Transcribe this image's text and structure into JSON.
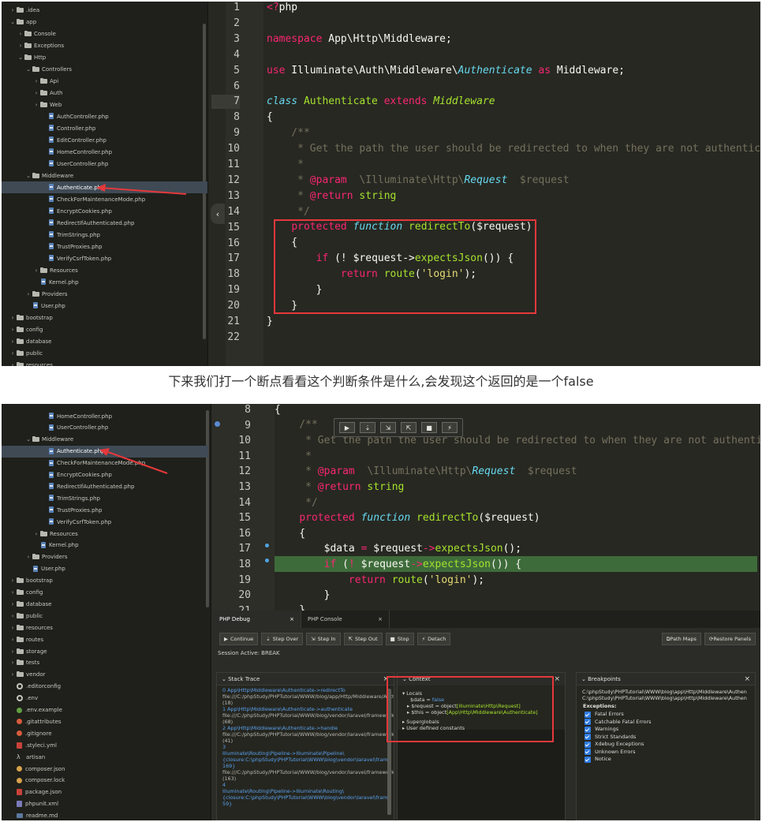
{
  "screenshot1": {
    "tree": [
      {
        "label": ".idea",
        "arrow": "›",
        "icon": "folder"
      },
      {
        "label": "app",
        "arrow": "⌄",
        "icon": "folder"
      },
      {
        "label": "Console",
        "arrow": "›",
        "icon": "folder"
      },
      {
        "label": "Exceptions",
        "arrow": "›",
        "icon": "folder"
      },
      {
        "label": "Http",
        "arrow": "⌄",
        "icon": "folder"
      },
      {
        "label": "Controllers",
        "arrow": "⌄",
        "icon": "folder"
      },
      {
        "label": "Api",
        "arrow": "›",
        "icon": "folder"
      },
      {
        "label": "Auth",
        "arrow": "›",
        "icon": "folder"
      },
      {
        "label": "Web",
        "arrow": "›",
        "icon": "folder"
      },
      {
        "label": "AuthController.php",
        "arrow": "",
        "icon": "php"
      },
      {
        "label": "Controller.php",
        "arrow": "",
        "icon": "php"
      },
      {
        "label": "EditController.php",
        "arrow": "",
        "icon": "php"
      },
      {
        "label": "HomeController.php",
        "arrow": "",
        "icon": "php"
      },
      {
        "label": "UserController.php",
        "arrow": "",
        "icon": "php"
      },
      {
        "label": "Middleware",
        "arrow": "⌄",
        "icon": "folder"
      },
      {
        "label": "Authenticate.php",
        "arrow": "",
        "icon": "php",
        "selected": true
      },
      {
        "label": "CheckForMaintenanceMode.php",
        "arrow": "",
        "icon": "php"
      },
      {
        "label": "EncryptCookies.php",
        "arrow": "",
        "icon": "php"
      },
      {
        "label": "RedirectIfAuthenticated.php",
        "arrow": "",
        "icon": "php"
      },
      {
        "label": "TrimStrings.php",
        "arrow": "",
        "icon": "php"
      },
      {
        "label": "TrustProxies.php",
        "arrow": "",
        "icon": "php"
      },
      {
        "label": "VerifyCsrfToken.php",
        "arrow": "",
        "icon": "php"
      },
      {
        "label": "Resources",
        "arrow": "›",
        "icon": "folder"
      },
      {
        "label": "Kernel.php",
        "arrow": "",
        "icon": "php"
      },
      {
        "label": "Providers",
        "arrow": "›",
        "icon": "folder"
      },
      {
        "label": "User.php",
        "arrow": "",
        "icon": "php"
      },
      {
        "label": "bootstrap",
        "arrow": "›",
        "icon": "folder"
      },
      {
        "label": "config",
        "arrow": "›",
        "icon": "folder"
      },
      {
        "label": "database",
        "arrow": "›",
        "icon": "folder"
      },
      {
        "label": "public",
        "arrow": "›",
        "icon": "folder"
      },
      {
        "label": "resources",
        "arrow": "›",
        "icon": "folder"
      }
    ],
    "collapse_glyph": "‹",
    "line_numbers": [
      "1",
      "2",
      "3",
      "4",
      "5",
      "6",
      "7",
      "8",
      "9",
      "10",
      "11",
      "12",
      "13",
      "14",
      "15",
      "16",
      "17",
      "18",
      "19",
      "20",
      "21",
      "22"
    ]
  },
  "caption": "下来我们打一个断点看看这个判断条件是什么,会发现这个返回的是一个false",
  "screenshot2": {
    "tree": [
      {
        "label": "HomeController.php",
        "arrow": "",
        "icon": "php"
      },
      {
        "label": "UserController.php",
        "arrow": "",
        "icon": "php"
      },
      {
        "label": "Middleware",
        "arrow": "⌄",
        "icon": "folder"
      },
      {
        "label": "Authenticate.php",
        "arrow": "",
        "icon": "php",
        "selected": true
      },
      {
        "label": "CheckForMaintenanceMode.php",
        "arrow": "",
        "icon": "php"
      },
      {
        "label": "EncryptCookies.php",
        "arrow": "",
        "icon": "php"
      },
      {
        "label": "RedirectIfAuthenticated.php",
        "arrow": "",
        "icon": "php"
      },
      {
        "label": "TrimStrings.php",
        "arrow": "",
        "icon": "php"
      },
      {
        "label": "TrustProxies.php",
        "arrow": "",
        "icon": "php"
      },
      {
        "label": "VerifyCsrfToken.php",
        "arrow": "",
        "icon": "php"
      },
      {
        "label": "Resources",
        "arrow": "›",
        "icon": "folder"
      },
      {
        "label": "Kernel.php",
        "arrow": "",
        "icon": "php"
      },
      {
        "label": "Providers",
        "arrow": "›",
        "icon": "folder"
      },
      {
        "label": "User.php",
        "arrow": "",
        "icon": "php"
      },
      {
        "label": "bootstrap",
        "arrow": "›",
        "icon": "folder"
      },
      {
        "label": "config",
        "arrow": "›",
        "icon": "folder"
      },
      {
        "label": "database",
        "arrow": "›",
        "icon": "folder"
      },
      {
        "label": "public",
        "arrow": "›",
        "icon": "folder"
      },
      {
        "label": "resources",
        "arrow": "›",
        "icon": "folder"
      },
      {
        "label": "routes",
        "arrow": "›",
        "icon": "folder"
      },
      {
        "label": "storage",
        "arrow": "›",
        "icon": "folder"
      },
      {
        "label": "tests",
        "arrow": "›",
        "icon": "folder"
      },
      {
        "label": "vendor",
        "arrow": "›",
        "icon": "folder"
      },
      {
        "label": ".editorconfig",
        "arrow": "",
        "icon": "gear"
      },
      {
        "label": ".env",
        "arrow": "",
        "icon": "gear"
      },
      {
        "label": ".env.example",
        "arrow": "",
        "icon": "env"
      },
      {
        "label": ".gitattributes",
        "arrow": "",
        "icon": "git"
      },
      {
        "label": ".gitignore",
        "arrow": "",
        "icon": "git"
      },
      {
        "label": ".styleci.yml",
        "arrow": "",
        "icon": "red"
      },
      {
        "label": "artisan",
        "arrow": "",
        "icon": "lambda"
      },
      {
        "label": "composer.json",
        "arrow": "",
        "icon": "json"
      },
      {
        "label": "composer.lock",
        "arrow": "",
        "icon": "json"
      },
      {
        "label": "package.json",
        "arrow": "",
        "icon": "red"
      },
      {
        "label": "phpunit.xml",
        "arrow": "",
        "icon": "xml"
      },
      {
        "label": "readme.md",
        "arrow": "",
        "icon": "md"
      }
    ],
    "line_numbers": [
      "8",
      "9",
      "10",
      "11",
      "12",
      "13",
      "14",
      "15",
      "16",
      "17",
      "18",
      "19",
      "20",
      "21"
    ],
    "debug_toolbar": [
      "▶",
      "⇣",
      "⇲",
      "⇱",
      "■",
      "⚡"
    ],
    "panel": {
      "tabs": [
        {
          "label": "PHP Debug",
          "close": "×"
        },
        {
          "label": "PHP Console",
          "close": "×"
        }
      ],
      "toolbar": [
        {
          "icon": "▶",
          "label": "Continue"
        },
        {
          "icon": "⇣",
          "label": "Step Over"
        },
        {
          "icon": "⇲",
          "label": "Step In"
        },
        {
          "icon": "⇱",
          "label": "Step Out"
        },
        {
          "icon": "■",
          "label": "Stop"
        },
        {
          "icon": "⚡",
          "label": "Detach"
        }
      ],
      "toolbar_right": [
        "⧉Path Maps",
        "⟳Restore Panels"
      ],
      "session": "Session Active: BREAK",
      "stack_trace": {
        "title": "Stack Trace",
        "lines": [
          {
            "t": "link",
            "text": "0  App\\Http\\Middleware\\Authenticate->redirectTo"
          },
          {
            "t": "path",
            "text": "file:///C:/phpStudy/PHPTutorial/WWW/blog/app/Http/Middleware/Authent"
          },
          {
            "t": "path",
            "text": "(18)"
          },
          {
            "t": "link",
            "text": "1  App\\Http\\Middleware\\Authenticate->authenticate"
          },
          {
            "t": "path",
            "text": "file:///C:/phpStudy/PHPTutorial/WWW/blog/vendor/laravel/framework/src/"
          },
          {
            "t": "path",
            "text": "(68)"
          },
          {
            "t": "link",
            "text": "2  App\\Http\\Middleware\\Authenticate->handle"
          },
          {
            "t": "path",
            "text": "file:///C:/phpStudy/PHPTutorial/WWW/blog/vendor/laravel/framework/src/"
          },
          {
            "t": "path",
            "text": "(41)"
          },
          {
            "t": "link",
            "text": "3"
          },
          {
            "t": "link",
            "text": "Illuminate\\Routing\\Pipeline->Illuminate\\Pipeline\\"
          },
          {
            "t": "link",
            "text": "{closure:C:\\phpStudy\\PHPTutorial\\WWW\\blog\\vendor\\laravel\\frame"
          },
          {
            "t": "link",
            "text": "169}"
          },
          {
            "t": "path",
            "text": "file:///C:/phpStudy/PHPTutorial/WWW/blog/vendor/laravel/framework/src/"
          },
          {
            "t": "path",
            "text": "(163)"
          },
          {
            "t": "link",
            "text": "4"
          },
          {
            "t": "link",
            "text": "Illuminate\\Routing\\Pipeline->Illuminate\\Routing\\"
          },
          {
            "t": "link",
            "text": "{closure:C:\\phpStudy\\PHPTutorial\\WWW\\blog\\vendor\\laravel\\frame"
          },
          {
            "t": "link",
            "text": "59}"
          }
        ]
      },
      "context": {
        "title": "Context",
        "locals_label": "▾ Locals",
        "data_name": "$data",
        "data_eq": " = ",
        "data_value": "false",
        "req_name": "▸ $request",
        "req_eq": " = object",
        "req_class": "[Illuminate\\Http\\Request]",
        "this_name": "▸ $this",
        "this_eq": " = object",
        "this_class": "[App\\Http\\Middleware\\Authenticate]",
        "superglobals": "▸ Superglobals",
        "user_constants": "▸ User defined constants"
      },
      "breakpoints": {
        "title": "Breakpoints",
        "files": [
          "C:\\phpStudy\\PHPTutorial\\WWW\\blog\\app\\Http\\Middleware\\Authen",
          "C:\\phpStudy\\PHPTutorial\\WWW\\blog\\app\\Http\\Middleware\\Authen"
        ],
        "exceptions_label": "Exceptions:",
        "exceptions": [
          "Fatal Errors",
          "Catchable Fatal Errors",
          "Warnings",
          "Strict Standards",
          "Xdebug Exceptions",
          "Unknown Errors",
          "Notice"
        ]
      }
    }
  }
}
